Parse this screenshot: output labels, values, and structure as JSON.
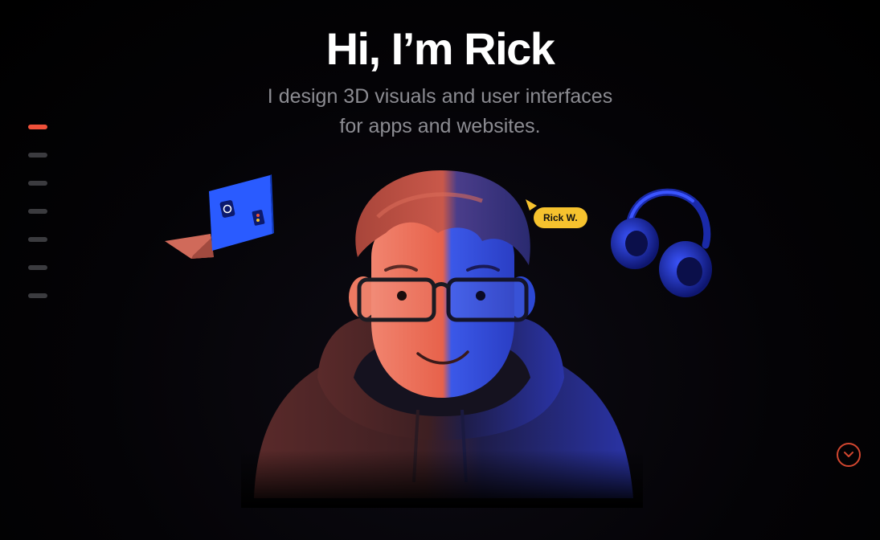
{
  "hero": {
    "title": "Hi, I’m Rick",
    "subtitle_line1": "I design 3D visuals and user interfaces",
    "subtitle_line2": "for apps and websites."
  },
  "name_tag": {
    "label": "Rick W."
  },
  "section_nav": {
    "count": 7,
    "active_index": 0
  },
  "icons": {
    "laptop": "laptop-icon",
    "headphones": "headphones-icon",
    "cursor": "pointer-cursor-icon",
    "scroll": "chevron-down-icon"
  },
  "colors": {
    "accent": "#f0513a",
    "tag": "#f6c22e",
    "blue": "#2f5bff",
    "background": "#000000"
  }
}
